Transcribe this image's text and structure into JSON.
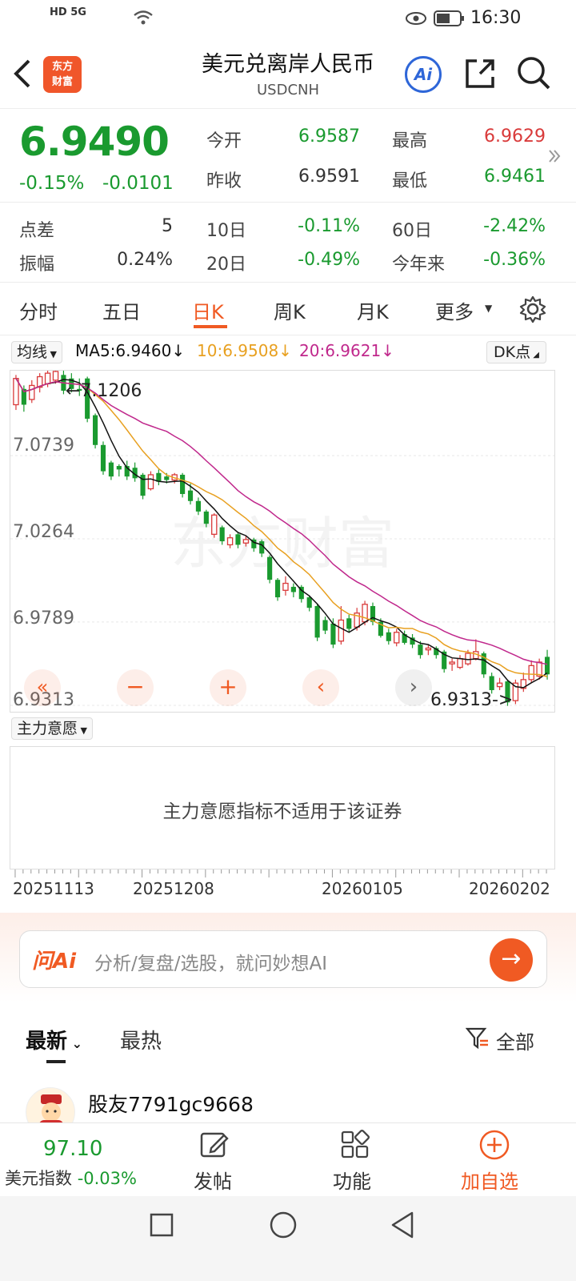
{
  "status": {
    "time": "16:30",
    "left_icons": "HD 5G"
  },
  "header": {
    "title": "美元兑离岸人民币",
    "subtitle": "USDCNH",
    "logo_line1": "东方",
    "logo_line2": "财富",
    "ai_label": "Ai"
  },
  "quote": {
    "price": "6.9490",
    "change_pct": "-0.15%",
    "change": "-0.0101",
    "open_label": "今开",
    "open": "6.9587",
    "high_label": "最高",
    "high": "6.9629",
    "prev_label": "昨收",
    "prev": "6.9591",
    "low_label": "最低",
    "low": "6.9461",
    "spread_label": "点差",
    "spread": "5",
    "d10_label": "10日",
    "d10": "-0.11%",
    "d60_label": "60日",
    "d60": "-2.42%",
    "amp_label": "振幅",
    "amp": "0.24%",
    "d20_label": "20日",
    "d20": "-0.49%",
    "ytd_label": "今年来",
    "ytd": "-0.36%"
  },
  "tabs": [
    "分时",
    "五日",
    "日K",
    "周K",
    "月K",
    "更多"
  ],
  "active_tab": "日K",
  "ma": {
    "btn": "均线",
    "ma5": "MA5:6.9460",
    "ma10": "10:6.9508",
    "ma20": "20:6.9621",
    "dk": "DK点"
  },
  "colors": {
    "up": "#d93a3a",
    "down": "#1a9a2f",
    "ma5": "#111111",
    "ma10": "#e8a020",
    "ma20": "#c0288c",
    "accent": "#f05a23"
  },
  "chart_data": {
    "type": "candlestick",
    "y_ticks": [
      "7.0739",
      "7.0264",
      "6.9789",
      "6.9313"
    ],
    "ylim": [
      6.9313,
      7.1206
    ],
    "max_label": "7.1206",
    "min_label": "6.9313->",
    "x_labels": [
      "20251113",
      "20251208",
      "20260105",
      "20260202"
    ],
    "candles": [
      {
        "o": 7.103,
        "c": 7.118,
        "h": 7.12,
        "l": 7.1
      },
      {
        "o": 7.112,
        "c": 7.103,
        "h": 7.114,
        "l": 7.099
      },
      {
        "o": 7.106,
        "c": 7.114,
        "h": 7.117,
        "l": 7.104
      },
      {
        "o": 7.113,
        "c": 7.119,
        "h": 7.121,
        "l": 7.11
      },
      {
        "o": 7.115,
        "c": 7.121,
        "h": 7.123,
        "l": 7.113
      },
      {
        "o": 7.117,
        "c": 7.122,
        "h": 7.124,
        "l": 7.115
      },
      {
        "o": 7.12,
        "c": 7.111,
        "h": 7.123,
        "l": 7.109
      },
      {
        "o": 7.118,
        "c": 7.112,
        "h": 7.121,
        "l": 7.11
      },
      {
        "o": 7.112,
        "c": 7.111,
        "h": 7.118,
        "l": 7.108
      },
      {
        "o": 7.118,
        "c": 7.095,
        "h": 7.119,
        "l": 7.093
      },
      {
        "o": 7.097,
        "c": 7.08,
        "h": 7.098,
        "l": 7.078
      },
      {
        "o": 7.08,
        "c": 7.065,
        "h": 7.082,
        "l": 7.063
      },
      {
        "o": 7.07,
        "c": 7.062,
        "h": 7.071,
        "l": 7.06
      },
      {
        "o": 7.068,
        "c": 7.066,
        "h": 7.069,
        "l": 7.062
      },
      {
        "o": 7.068,
        "c": 7.062,
        "h": 7.071,
        "l": 7.06
      },
      {
        "o": 7.067,
        "c": 7.061,
        "h": 7.07,
        "l": 7.059
      },
      {
        "o": 7.063,
        "c": 7.051,
        "h": 7.064,
        "l": 7.049
      },
      {
        "o": 7.055,
        "c": 7.063,
        "h": 7.065,
        "l": 7.054
      },
      {
        "o": 7.064,
        "c": 7.059,
        "h": 7.066,
        "l": 7.057
      },
      {
        "o": 7.062,
        "c": 7.06,
        "h": 7.064,
        "l": 7.058
      },
      {
        "o": 7.06,
        "c": 7.063,
        "h": 7.064,
        "l": 7.058
      },
      {
        "o": 7.063,
        "c": 7.052,
        "h": 7.064,
        "l": 7.05
      },
      {
        "o": 7.054,
        "c": 7.048,
        "h": 7.058,
        "l": 7.046
      },
      {
        "o": 7.048,
        "c": 7.042,
        "h": 7.05,
        "l": 7.04
      },
      {
        "o": 7.042,
        "c": 7.035,
        "h": 7.043,
        "l": 7.033
      },
      {
        "o": 7.029,
        "c": 7.04,
        "h": 7.041,
        "l": 7.027
      },
      {
        "o": 7.033,
        "c": 7.025,
        "h": 7.034,
        "l": 7.023
      },
      {
        "o": 7.023,
        "c": 7.027,
        "h": 7.029,
        "l": 7.021
      },
      {
        "o": 7.029,
        "c": 7.023,
        "h": 7.03,
        "l": 7.021
      },
      {
        "o": 7.024,
        "c": 7.026,
        "h": 7.028,
        "l": 7.022
      },
      {
        "o": 7.026,
        "c": 7.021,
        "h": 7.027,
        "l": 7.019
      },
      {
        "o": 7.025,
        "c": 7.018,
        "h": 7.026,
        "l": 7.016
      },
      {
        "o": 7.016,
        "c": 7.003,
        "h": 7.017,
        "l": 7.001
      },
      {
        "o": 7.003,
        "c": 6.993,
        "h": 7.004,
        "l": 6.991
      },
      {
        "o": 6.997,
        "c": 7.001,
        "h": 7.005,
        "l": 6.994
      },
      {
        "o": 6.999,
        "c": 6.996,
        "h": 7.001,
        "l": 6.993
      },
      {
        "o": 6.999,
        "c": 6.992,
        "h": 7.0,
        "l": 6.99
      },
      {
        "o": 6.993,
        "c": 6.987,
        "h": 6.994,
        "l": 6.985
      },
      {
        "o": 6.988,
        "c": 6.97,
        "h": 6.989,
        "l": 6.968
      },
      {
        "o": 6.98,
        "c": 6.974,
        "h": 6.982,
        "l": 6.972
      },
      {
        "o": 6.978,
        "c": 6.966,
        "h": 6.981,
        "l": 6.964
      },
      {
        "o": 6.968,
        "c": 6.98,
        "h": 6.988,
        "l": 6.966
      },
      {
        "o": 6.981,
        "c": 6.975,
        "h": 6.983,
        "l": 6.973
      },
      {
        "o": 6.976,
        "c": 6.984,
        "h": 6.987,
        "l": 6.974
      },
      {
        "o": 6.979,
        "c": 6.989,
        "h": 6.991,
        "l": 6.977
      },
      {
        "o": 6.988,
        "c": 6.979,
        "h": 6.99,
        "l": 6.977
      },
      {
        "o": 6.979,
        "c": 6.971,
        "h": 6.981,
        "l": 6.97
      },
      {
        "o": 6.973,
        "c": 6.968,
        "h": 6.975,
        "l": 6.966
      },
      {
        "o": 6.967,
        "c": 6.973,
        "h": 6.975,
        "l": 6.965
      },
      {
        "o": 6.972,
        "c": 6.967,
        "h": 6.974,
        "l": 6.966
      },
      {
        "o": 6.97,
        "c": 6.966,
        "h": 6.972,
        "l": 6.964
      },
      {
        "o": 6.966,
        "c": 6.96,
        "h": 6.968,
        "l": 6.958
      },
      {
        "o": 6.963,
        "c": 6.964,
        "h": 6.966,
        "l": 6.96
      },
      {
        "o": 6.964,
        "c": 6.96,
        "h": 6.965,
        "l": 6.958
      },
      {
        "o": 6.962,
        "c": 6.952,
        "h": 6.963,
        "l": 6.95
      },
      {
        "o": 6.955,
        "c": 6.956,
        "h": 6.958,
        "l": 6.951
      },
      {
        "o": 6.953,
        "c": 6.958,
        "h": 6.96,
        "l": 6.952
      },
      {
        "o": 6.955,
        "c": 6.961,
        "h": 6.963,
        "l": 6.954
      },
      {
        "o": 6.958,
        "c": 6.962,
        "h": 6.969,
        "l": 6.957
      },
      {
        "o": 6.961,
        "c": 6.949,
        "h": 6.962,
        "l": 6.947
      },
      {
        "o": 6.948,
        "c": 6.94,
        "h": 6.95,
        "l": 6.938
      },
      {
        "o": 6.942,
        "c": 6.944,
        "h": 6.947,
        "l": 6.94
      },
      {
        "o": 6.945,
        "c": 6.933,
        "h": 6.946,
        "l": 6.931
      },
      {
        "o": 6.934,
        "c": 6.944,
        "h": 6.946,
        "l": 6.932
      },
      {
        "o": 6.941,
        "c": 6.946,
        "h": 6.95,
        "l": 6.939
      },
      {
        "o": 6.946,
        "c": 6.954,
        "h": 6.957,
        "l": 6.944
      },
      {
        "o": 6.948,
        "c": 6.956,
        "h": 6.958,
        "l": 6.946
      },
      {
        "o": 6.959,
        "c": 6.949,
        "h": 6.963,
        "l": 6.946
      }
    ]
  },
  "indicator": {
    "btn": "主力意愿",
    "message": "主力意愿指标不适用于该证券"
  },
  "ai": {
    "logo": "问Ai",
    "placeholder": "分析/复盘/选股，就问妙想AI",
    "go": "→"
  },
  "feed": {
    "tab_latest": "最新",
    "tab_hot": "最热",
    "filter": "全部",
    "user": "股友7791gc9668"
  },
  "bottom": {
    "index_value": "97.10",
    "index_name": "美元指数",
    "index_change": "-0.03%",
    "post": "发帖",
    "func": "功能",
    "watch": "加自选"
  }
}
